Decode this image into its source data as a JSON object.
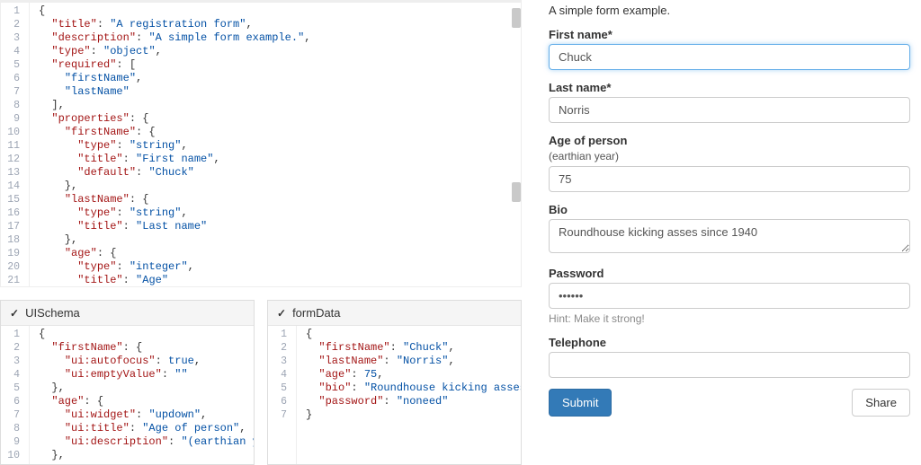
{
  "editors": {
    "jsonSchema": {
      "lines": [
        [
          {
            "c": "brace",
            "t": "{"
          }
        ],
        [
          {
            "c": "pun",
            "t": "  "
          },
          {
            "c": "key",
            "t": "\"title\""
          },
          {
            "c": "pun",
            "t": ": "
          },
          {
            "c": "str",
            "t": "\"A registration form\""
          },
          {
            "c": "pun",
            "t": ","
          }
        ],
        [
          {
            "c": "pun",
            "t": "  "
          },
          {
            "c": "key",
            "t": "\"description\""
          },
          {
            "c": "pun",
            "t": ": "
          },
          {
            "c": "str",
            "t": "\"A simple form example.\""
          },
          {
            "c": "pun",
            "t": ","
          }
        ],
        [
          {
            "c": "pun",
            "t": "  "
          },
          {
            "c": "key",
            "t": "\"type\""
          },
          {
            "c": "pun",
            "t": ": "
          },
          {
            "c": "str",
            "t": "\"object\""
          },
          {
            "c": "pun",
            "t": ","
          }
        ],
        [
          {
            "c": "pun",
            "t": "  "
          },
          {
            "c": "key",
            "t": "\"required\""
          },
          {
            "c": "pun",
            "t": ": ["
          }
        ],
        [
          {
            "c": "pun",
            "t": "    "
          },
          {
            "c": "str",
            "t": "\"firstName\""
          },
          {
            "c": "pun",
            "t": ","
          }
        ],
        [
          {
            "c": "pun",
            "t": "    "
          },
          {
            "c": "str",
            "t": "\"lastName\""
          }
        ],
        [
          {
            "c": "pun",
            "t": "  ],"
          }
        ],
        [
          {
            "c": "pun",
            "t": "  "
          },
          {
            "c": "key",
            "t": "\"properties\""
          },
          {
            "c": "pun",
            "t": ": {"
          }
        ],
        [
          {
            "c": "pun",
            "t": "    "
          },
          {
            "c": "key",
            "t": "\"firstName\""
          },
          {
            "c": "pun",
            "t": ": {"
          }
        ],
        [
          {
            "c": "pun",
            "t": "      "
          },
          {
            "c": "key",
            "t": "\"type\""
          },
          {
            "c": "pun",
            "t": ": "
          },
          {
            "c": "str",
            "t": "\"string\""
          },
          {
            "c": "pun",
            "t": ","
          }
        ],
        [
          {
            "c": "pun",
            "t": "      "
          },
          {
            "c": "key",
            "t": "\"title\""
          },
          {
            "c": "pun",
            "t": ": "
          },
          {
            "c": "str",
            "t": "\"First name\""
          },
          {
            "c": "pun",
            "t": ","
          }
        ],
        [
          {
            "c": "pun",
            "t": "      "
          },
          {
            "c": "key",
            "t": "\"default\""
          },
          {
            "c": "pun",
            "t": ": "
          },
          {
            "c": "str",
            "t": "\"Chuck\""
          }
        ],
        [
          {
            "c": "pun",
            "t": "    },"
          }
        ],
        [
          {
            "c": "pun",
            "t": "    "
          },
          {
            "c": "key",
            "t": "\"lastName\""
          },
          {
            "c": "pun",
            "t": ": {"
          }
        ],
        [
          {
            "c": "pun",
            "t": "      "
          },
          {
            "c": "key",
            "t": "\"type\""
          },
          {
            "c": "pun",
            "t": ": "
          },
          {
            "c": "str",
            "t": "\"string\""
          },
          {
            "c": "pun",
            "t": ","
          }
        ],
        [
          {
            "c": "pun",
            "t": "      "
          },
          {
            "c": "key",
            "t": "\"title\""
          },
          {
            "c": "pun",
            "t": ": "
          },
          {
            "c": "str",
            "t": "\"Last name\""
          }
        ],
        [
          {
            "c": "pun",
            "t": "    },"
          }
        ],
        [
          {
            "c": "pun",
            "t": "    "
          },
          {
            "c": "key",
            "t": "\"age\""
          },
          {
            "c": "pun",
            "t": ": {"
          }
        ],
        [
          {
            "c": "pun",
            "t": "      "
          },
          {
            "c": "key",
            "t": "\"type\""
          },
          {
            "c": "pun",
            "t": ": "
          },
          {
            "c": "str",
            "t": "\"integer\""
          },
          {
            "c": "pun",
            "t": ","
          }
        ],
        [
          {
            "c": "pun",
            "t": "      "
          },
          {
            "c": "key",
            "t": "\"title\""
          },
          {
            "c": "pun",
            "t": ": "
          },
          {
            "c": "str",
            "t": "\"Age\""
          }
        ]
      ],
      "startLine": 1
    },
    "uiSchema": {
      "title": "UISchema",
      "lines": [
        [
          {
            "c": "brace",
            "t": "{"
          }
        ],
        [
          {
            "c": "pun",
            "t": "  "
          },
          {
            "c": "key",
            "t": "\"firstName\""
          },
          {
            "c": "pun",
            "t": ": {"
          }
        ],
        [
          {
            "c": "pun",
            "t": "    "
          },
          {
            "c": "key",
            "t": "\"ui:autofocus\""
          },
          {
            "c": "pun",
            "t": ": "
          },
          {
            "c": "kw",
            "t": "true"
          },
          {
            "c": "pun",
            "t": ","
          }
        ],
        [
          {
            "c": "pun",
            "t": "    "
          },
          {
            "c": "key",
            "t": "\"ui:emptyValue\""
          },
          {
            "c": "pun",
            "t": ": "
          },
          {
            "c": "str",
            "t": "\"\""
          }
        ],
        [
          {
            "c": "pun",
            "t": "  },"
          }
        ],
        [
          {
            "c": "pun",
            "t": "  "
          },
          {
            "c": "key",
            "t": "\"age\""
          },
          {
            "c": "pun",
            "t": ": {"
          }
        ],
        [
          {
            "c": "pun",
            "t": "    "
          },
          {
            "c": "key",
            "t": "\"ui:widget\""
          },
          {
            "c": "pun",
            "t": ": "
          },
          {
            "c": "str",
            "t": "\"updown\""
          },
          {
            "c": "pun",
            "t": ","
          }
        ],
        [
          {
            "c": "pun",
            "t": "    "
          },
          {
            "c": "key",
            "t": "\"ui:title\""
          },
          {
            "c": "pun",
            "t": ": "
          },
          {
            "c": "str",
            "t": "\"Age of person\""
          },
          {
            "c": "pun",
            "t": ","
          }
        ],
        [
          {
            "c": "pun",
            "t": "    "
          },
          {
            "c": "key",
            "t": "\"ui:description\""
          },
          {
            "c": "pun",
            "t": ": "
          },
          {
            "c": "str",
            "t": "\"(earthian year)"
          }
        ],
        [
          {
            "c": "pun",
            "t": "  },"
          }
        ]
      ],
      "startLine": 1
    },
    "formData": {
      "title": "formData",
      "lines": [
        [
          {
            "c": "brace",
            "t": "{"
          }
        ],
        [
          {
            "c": "pun",
            "t": "  "
          },
          {
            "c": "key",
            "t": "\"firstName\""
          },
          {
            "c": "pun",
            "t": ": "
          },
          {
            "c": "str",
            "t": "\"Chuck\""
          },
          {
            "c": "pun",
            "t": ","
          }
        ],
        [
          {
            "c": "pun",
            "t": "  "
          },
          {
            "c": "key",
            "t": "\"lastName\""
          },
          {
            "c": "pun",
            "t": ": "
          },
          {
            "c": "str",
            "t": "\"Norris\""
          },
          {
            "c": "pun",
            "t": ","
          }
        ],
        [
          {
            "c": "pun",
            "t": "  "
          },
          {
            "c": "key",
            "t": "\"age\""
          },
          {
            "c": "pun",
            "t": ": "
          },
          {
            "c": "kw",
            "t": "75"
          },
          {
            "c": "pun",
            "t": ","
          }
        ],
        [
          {
            "c": "pun",
            "t": "  "
          },
          {
            "c": "key",
            "t": "\"bio\""
          },
          {
            "c": "pun",
            "t": ": "
          },
          {
            "c": "str",
            "t": "\"Roundhouse kicking asses sin"
          }
        ],
        [
          {
            "c": "pun",
            "t": "  "
          },
          {
            "c": "key",
            "t": "\"password\""
          },
          {
            "c": "pun",
            "t": ": "
          },
          {
            "c": "str",
            "t": "\"noneed\""
          }
        ],
        [
          {
            "c": "brace",
            "t": "}"
          }
        ]
      ],
      "startLine": 1
    }
  },
  "form": {
    "description": "A simple form example.",
    "fields": {
      "firstName": {
        "label": "First name",
        "required": true,
        "value": "Chuck"
      },
      "lastName": {
        "label": "Last name",
        "required": true,
        "value": "Norris"
      },
      "age": {
        "label": "Age of person",
        "description": "(earthian year)",
        "value": "75"
      },
      "bio": {
        "label": "Bio",
        "value": "Roundhouse kicking asses since 1940"
      },
      "password": {
        "label": "Password",
        "value": "••••••",
        "hint": "Hint: Make it strong!"
      },
      "telephone": {
        "label": "Telephone",
        "value": ""
      }
    },
    "submit": "Submit",
    "share": "Share"
  }
}
